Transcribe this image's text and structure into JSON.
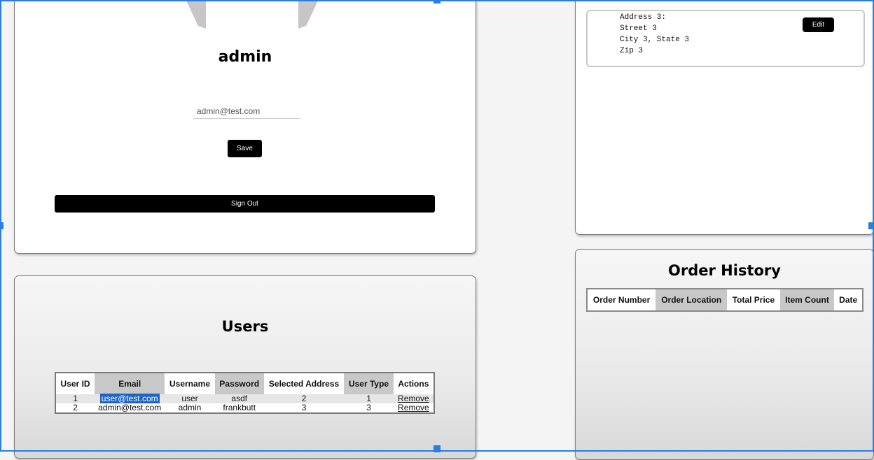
{
  "profile": {
    "username": "admin",
    "email_value": "admin@test.com",
    "save_label": "Save",
    "signout_label": "Sign Out"
  },
  "address": {
    "lines": [
      "Address 3:",
      "Street 3",
      "City 3, State 3",
      "Zip 3"
    ],
    "edit_label": "Edit"
  },
  "users": {
    "title": "Users",
    "columns": [
      "User ID",
      "Email",
      "Username",
      "Password",
      "Selected Address",
      "User Type",
      "Actions"
    ],
    "rows": [
      {
        "id": "1",
        "email": "user@test.com",
        "username": "user",
        "password": "asdf",
        "address": "2",
        "type": "1",
        "action": "Remove"
      },
      {
        "id": "2",
        "email": "admin@test.com",
        "username": "admin",
        "password": "frankbutt",
        "address": "3",
        "type": "3",
        "action": "Remove"
      }
    ]
  },
  "orders": {
    "title": "Order History",
    "columns": [
      "Order Number",
      "Order Location",
      "Total Price",
      "Item Count",
      "Date"
    ]
  },
  "colors": {
    "selection_frame": "#2a7de1",
    "button": "#000000",
    "text_highlight": "#1c64c8"
  }
}
